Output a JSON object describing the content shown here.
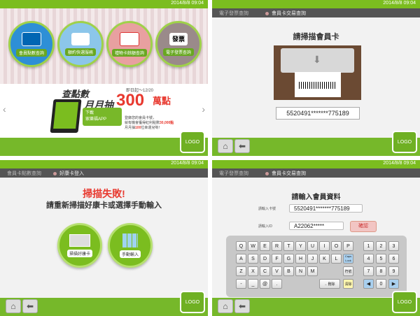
{
  "timestamp": "2014/8/8 09:04",
  "logo": "LOGO",
  "screen1": {
    "menu": [
      "會員點數查詢",
      "額約快選服務",
      "禮物卡餘額查詢",
      "電子發票查詢"
    ],
    "icon_labels": [
      "發票"
    ],
    "banner": {
      "line1": "查點數",
      "line2": "月月抽",
      "amount": "300",
      "unit": "萬點",
      "date": "即日起～12/20",
      "app_title": "下載",
      "app_name": "家樂福APP",
      "note1": "登錄您的會員卡號，",
      "note2": "就有機會獲得紅利點數",
      "note2_value": "30,000點",
      "note3": "月月抽",
      "note3_value": "100",
      "note3_tail": "位幸運兒喲！"
    }
  },
  "screen2": {
    "crumb1": "電子發票查詢",
    "crumb2": "會員卡交易查詢",
    "title": "請掃描會員卡",
    "card_number": "5520491*******775189"
  },
  "screen3": {
    "crumb1": "會員卡點數查詢",
    "crumb2": "好康卡登入",
    "fail_title": "掃描失敗!",
    "fail_msg": "請重新掃描好康卡或選擇手動輸入",
    "btn_scan": "掃描好康卡",
    "btn_manual": "手動輸入"
  },
  "screen4": {
    "crumb1": "電子發票查詢",
    "crumb2": "會員卡交易查詢",
    "title": "請輸入會員資料",
    "label_card": "請輸入卡號",
    "label_id": "請輸入ID",
    "card_value": "5520491*******775189",
    "id_value": "A22062*****",
    "confirm": "確認",
    "row1": [
      "Q",
      "W",
      "E",
      "R",
      "T",
      "Y",
      "U",
      "I",
      "O",
      "P"
    ],
    "row2": [
      "A",
      "S",
      "D",
      "F",
      "G",
      "H",
      "J",
      "K",
      "L",
      "Caps Lock"
    ],
    "row3": [
      "Z",
      "X",
      "C",
      "V",
      "B",
      "N",
      "M",
      "符號"
    ],
    "row4": [
      "-",
      "_",
      "@",
      ".",
      "←刪除",
      "清除"
    ],
    "numpad": [
      "1",
      "2",
      "3",
      "4",
      "5",
      "6",
      "7",
      "8",
      "9",
      "0"
    ],
    "arrows": [
      "◀",
      "▶"
    ]
  }
}
